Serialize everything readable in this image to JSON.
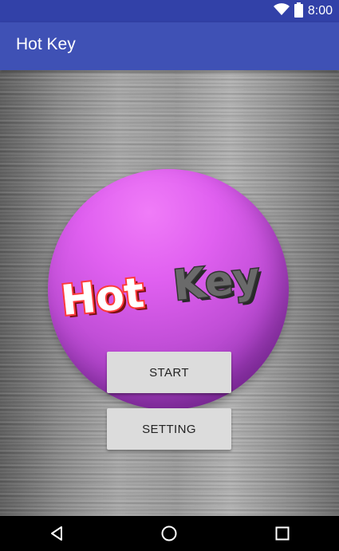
{
  "status_bar": {
    "time": "8:00",
    "icons": [
      "wifi-icon",
      "battery-icon"
    ]
  },
  "app_bar": {
    "title": "Hot Key"
  },
  "main": {
    "logo": {
      "word1": "Hot",
      "word2": "Key"
    },
    "buttons": {
      "start_label": "START",
      "setting_label": "SETTING"
    }
  },
  "nav_bar": {
    "icons": [
      "back-icon",
      "home-icon",
      "recents-icon"
    ]
  },
  "colors": {
    "status_bar": "#3241a8",
    "app_bar": "#3f51b5",
    "sphere": "#d75ae8",
    "logo_hot": "#ff4a4a",
    "logo_key": "#555555",
    "button_bg": "#dcdcdc"
  }
}
